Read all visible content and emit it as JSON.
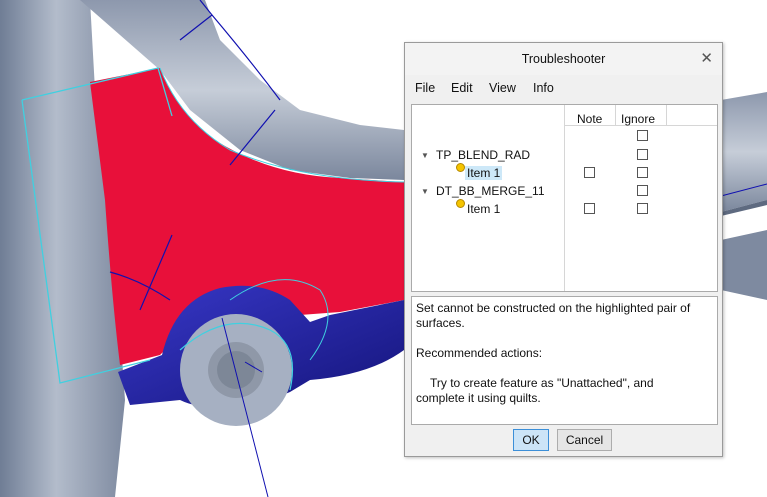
{
  "dialog": {
    "title": "Troubleshooter",
    "close_glyph": "✕",
    "menu": [
      "File",
      "Edit",
      "View",
      "Info"
    ],
    "columns": {
      "note": "Note",
      "ignore": "Ignore"
    },
    "tree": [
      {
        "label": "TP_BLEND_RAD",
        "expanded": true,
        "ignore": false
      },
      {
        "label": "Item 1",
        "icon": "status-dot-icon",
        "selected": true,
        "note": false,
        "ignore": false
      },
      {
        "label": "DT_BB_MERGE_11",
        "expanded": true,
        "ignore": false
      },
      {
        "label": "Item 1",
        "icon": "status-dot-icon",
        "selected": false,
        "note": false,
        "ignore": false
      }
    ],
    "message": {
      "line1": "Set cannot be constructed on the highlighted pair of",
      "line2": "surfaces.",
      "line3": "Recommended actions:",
      "line4": "Try to create feature as \"Unattached\", and",
      "line5": "complete it using quilts."
    },
    "buttons": {
      "ok": "OK",
      "cancel": "Cancel"
    }
  },
  "colors": {
    "surface_gray": "#a6b0c2",
    "highlight_red": "#e8103a",
    "boss_blue": "#2020a0",
    "edge_cyan": "#40d0e0",
    "edge_blue": "#1010b0"
  }
}
